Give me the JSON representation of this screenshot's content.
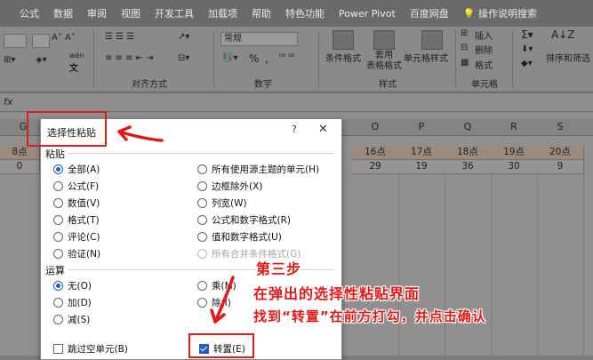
{
  "ribbon_tabs": [
    "公式",
    "数据",
    "审阅",
    "视图",
    "开发工具",
    "加载项",
    "帮助",
    "特色功能",
    "Power Pivot",
    "百度网盘",
    "操作说明搜索"
  ],
  "ribbon": {
    "number_format": "常规",
    "groups": {
      "alignment": "对齐方式",
      "number": "数字",
      "styles": "样式",
      "cells": "单元格"
    },
    "styles": {
      "conditional": "条件格式",
      "table_format": "套用\n表格格式",
      "cell_styles": "单元格样式"
    },
    "cells": {
      "insert": "插入",
      "delete": "删除",
      "format": "格式"
    },
    "editing": {
      "sort_filter": "排序和筛选"
    },
    "percent": "%",
    "wen": "wén"
  },
  "formula_bar": {
    "fx": "fx"
  },
  "sheet": {
    "col_headers": [
      "G",
      "O",
      "P",
      "Q",
      "R",
      "S"
    ],
    "row1": [
      "8点",
      "16点",
      "17点",
      "18点",
      "19点",
      "20点"
    ],
    "row2": [
      "0",
      "29",
      "19",
      "36",
      "30",
      "9"
    ]
  },
  "dialog": {
    "title": "选择性粘贴",
    "help": "?",
    "close": "✕",
    "paste_section": "粘贴",
    "paste_left": [
      {
        "label": "全部(A)",
        "selected": true
      },
      {
        "label": "公式(F)",
        "selected": false
      },
      {
        "label": "数值(V)",
        "selected": false
      },
      {
        "label": "格式(T)",
        "selected": false
      },
      {
        "label": "评论(C)",
        "selected": false
      },
      {
        "label": "验证(N)",
        "selected": false
      }
    ],
    "paste_right": [
      {
        "label": "所有使用源主题的单元(H)",
        "disabled": false
      },
      {
        "label": "边框除外(X)",
        "disabled": false
      },
      {
        "label": "列宽(W)",
        "disabled": false
      },
      {
        "label": "公式和数字格式(R)",
        "disabled": false
      },
      {
        "label": "值和数字格式(U)",
        "disabled": false
      },
      {
        "label": "所有合并条件格式(G)",
        "disabled": true
      }
    ],
    "operation_section": "运算",
    "op_left": [
      {
        "label": "无(O)",
        "selected": true
      },
      {
        "label": "加(D)",
        "selected": false
      },
      {
        "label": "减(S)",
        "selected": false
      }
    ],
    "op_right": [
      {
        "label": "乘(M)"
      },
      {
        "label": "除(I)"
      }
    ],
    "skip_blanks": "跳过空单元(B)",
    "transpose": "转置(E)"
  },
  "annotation": {
    "line1": "第三步",
    "line2": "在弹出的选择性粘贴界面",
    "line3": "找到“转置”在前方打勾，并点击确认"
  },
  "colors": {
    "annotation_red": "#e01818",
    "accent_blue": "#1f5fbf"
  }
}
